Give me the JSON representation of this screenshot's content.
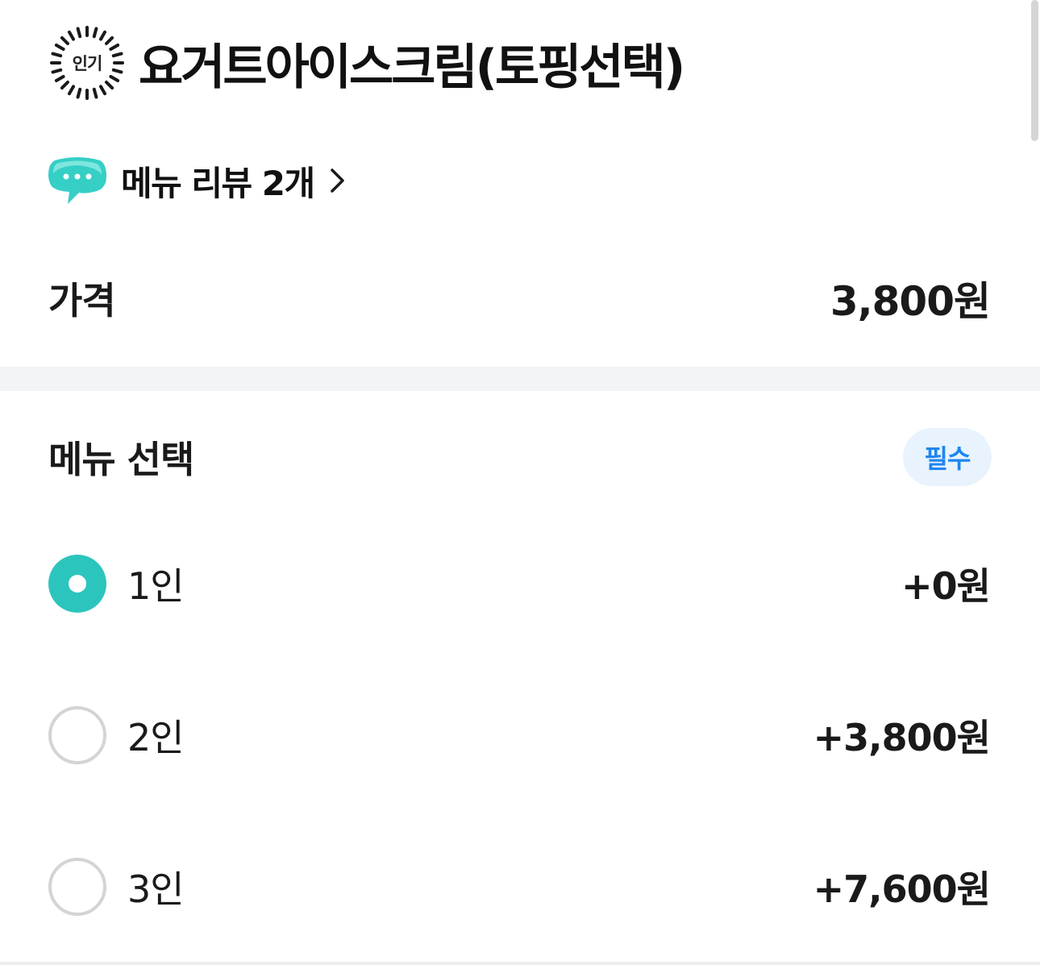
{
  "header": {
    "badge_label": "인기",
    "title": "요거트아이스크림(토핑선택)"
  },
  "review": {
    "icon": "speech-bubble-icon",
    "label": "메뉴 리뷰 2개",
    "chevron": "chevron-right-icon"
  },
  "price": {
    "label": "가격",
    "value": "3,800원"
  },
  "option_section": {
    "title": "메뉴 선택",
    "required_label": "필수",
    "options": [
      {
        "label": "1인",
        "price": "+0원",
        "selected": true
      },
      {
        "label": "2인",
        "price": "+3,800원",
        "selected": false
      },
      {
        "label": "3인",
        "price": "+7,600원",
        "selected": false
      }
    ]
  },
  "colors": {
    "accent": "#2cc5bd",
    "required_text": "#1f86f0",
    "required_bg": "#e8f3fe",
    "divider": "#f3f4f6",
    "radio_border": "#d4d4d4"
  }
}
